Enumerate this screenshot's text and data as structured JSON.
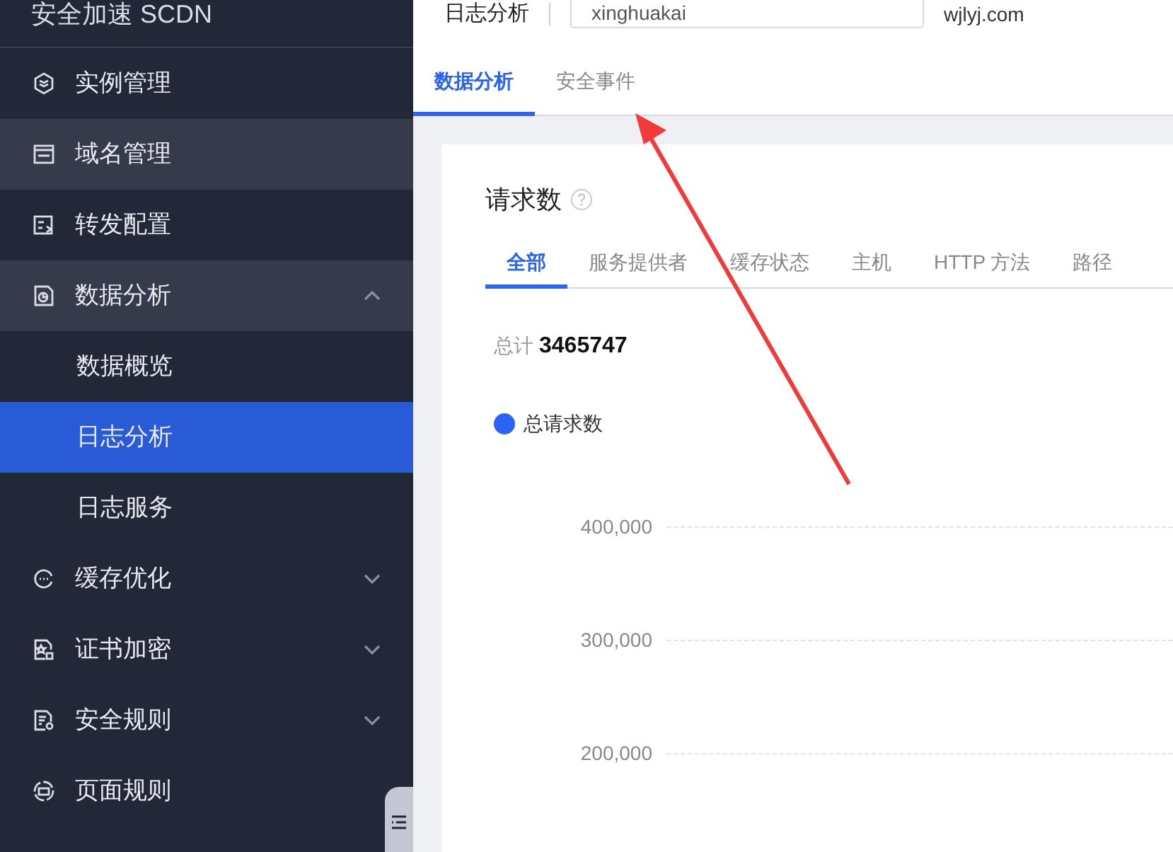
{
  "sidebar": {
    "title": "安全加速 SCDN",
    "items": [
      {
        "label": "实例管理",
        "selected": false,
        "highlighted": false
      },
      {
        "label": "域名管理",
        "selected": false,
        "highlighted": true
      },
      {
        "label": "转发配置",
        "selected": false,
        "highlighted": false
      },
      {
        "label": "数据分析",
        "selected": false,
        "highlighted": true,
        "expanded": true,
        "children": [
          {
            "label": "数据概览",
            "selected": false
          },
          {
            "label": "日志分析",
            "selected": true
          },
          {
            "label": "日志服务",
            "selected": false
          }
        ]
      },
      {
        "label": "缓存优化",
        "selected": false,
        "highlighted": false,
        "expanded": false
      },
      {
        "label": "证书加密",
        "selected": false,
        "highlighted": false,
        "expanded": false
      },
      {
        "label": "安全规则",
        "selected": false,
        "highlighted": false,
        "expanded": false
      },
      {
        "label": "页面规则",
        "selected": false,
        "highlighted": false
      }
    ]
  },
  "header": {
    "title": "日志分析",
    "instance": "xinghuakai",
    "domain": "wjlyj.com"
  },
  "tabs": [
    {
      "label": "数据分析",
      "selected": true
    },
    {
      "label": "安全事件",
      "selected": false
    }
  ],
  "card": {
    "title": "请求数",
    "subtabs": [
      {
        "label": "全部",
        "selected": true
      },
      {
        "label": "服务提供者",
        "selected": false
      },
      {
        "label": "缓存状态",
        "selected": false
      },
      {
        "label": "主机",
        "selected": false
      },
      {
        "label": "HTTP 方法",
        "selected": false
      },
      {
        "label": "路径",
        "selected": false
      }
    ],
    "total_label": "总计",
    "total_value": "3465747",
    "legend": [
      {
        "label": "总请求数",
        "color": "#2b64f5"
      }
    ],
    "y_axis_labels": [
      "400,000",
      "300,000",
      "200,000"
    ]
  }
}
